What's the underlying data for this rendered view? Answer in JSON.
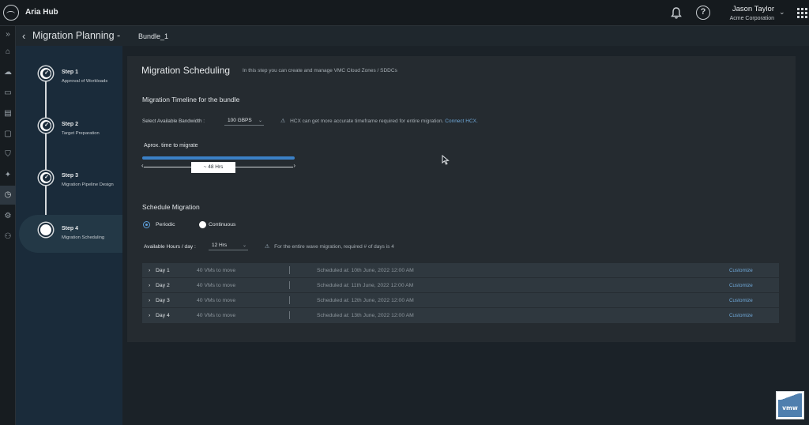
{
  "header": {
    "app_title": "Aria Hub",
    "user_name": "Jason Taylor",
    "user_org": "Acme Corporation",
    "icons": [
      "logo-icon",
      "bell-icon",
      "help-icon",
      "chevron-down-icon",
      "app-grid-icon"
    ]
  },
  "nav_rail": {
    "icons": [
      "expand-icon",
      "home-icon",
      "cloud-icon",
      "truck-icon",
      "storage-icon",
      "monitor-icon",
      "shield-icon",
      "network-icon",
      "migration-icon",
      "settings-icon",
      "users-icon"
    ],
    "active": "migration-icon"
  },
  "page": {
    "title": "Migration Planning",
    "separator": "-",
    "bundle": "Bundle_1"
  },
  "steps": [
    {
      "title": "Step 1",
      "desc": "Approval of Workloads",
      "state": "done"
    },
    {
      "title": "Step 2",
      "desc": "Target Preparation",
      "state": "done"
    },
    {
      "title": "Step 3",
      "desc": "Migration Pipeline Design",
      "state": "done"
    },
    {
      "title": "Step 4",
      "desc": "Migration Scheduling",
      "state": "current"
    }
  ],
  "main": {
    "title": "Migration Scheduling",
    "hint": "In this step you can create and manage VMC Cloud Zones / SDDCs",
    "timeline": {
      "section_title": "Migration Timeline for the bundle",
      "bandwidth_label": "Select Available Bandwidth :",
      "bandwidth_value": "100 GBPS",
      "hcx_note": "HCX can get more accurate timeframe required for entire migration.",
      "hcx_link": "Connect HCX.",
      "approx_label": "Aprox. time to migrate",
      "approx_value": "~ 48 Hrs",
      "progress": 1.0
    },
    "schedule": {
      "section_title": "Schedule Migration",
      "mode_periodic": "Periodic",
      "mode_continuous": "Continuous",
      "mode_selected": "Periodic",
      "hours_label": "Available Hours / day :",
      "hours_value": "12 Hrs",
      "hours_note": "For the entire wave migration, required # of days is 4",
      "days": [
        {
          "name": "Day 1",
          "vms": "40 VMs to move",
          "scheduled": "Scheduled at: 10th June, 2022   12:00 AM",
          "action": "Customize"
        },
        {
          "name": "Day 2",
          "vms": "40 VMs to move",
          "scheduled": "Scheduled at: 11th June, 2022   12:00 AM",
          "action": "Customize"
        },
        {
          "name": "Day 3",
          "vms": "40 VMs to move",
          "scheduled": "Scheduled at: 12th June, 2022   12:00 AM",
          "action": "Customize"
        },
        {
          "name": "Day 4",
          "vms": "40 VMs to move",
          "scheduled": "Scheduled at: 13th June, 2022   12:00 AM",
          "action": "Customize"
        }
      ]
    }
  },
  "vmware_logo": "vmw"
}
